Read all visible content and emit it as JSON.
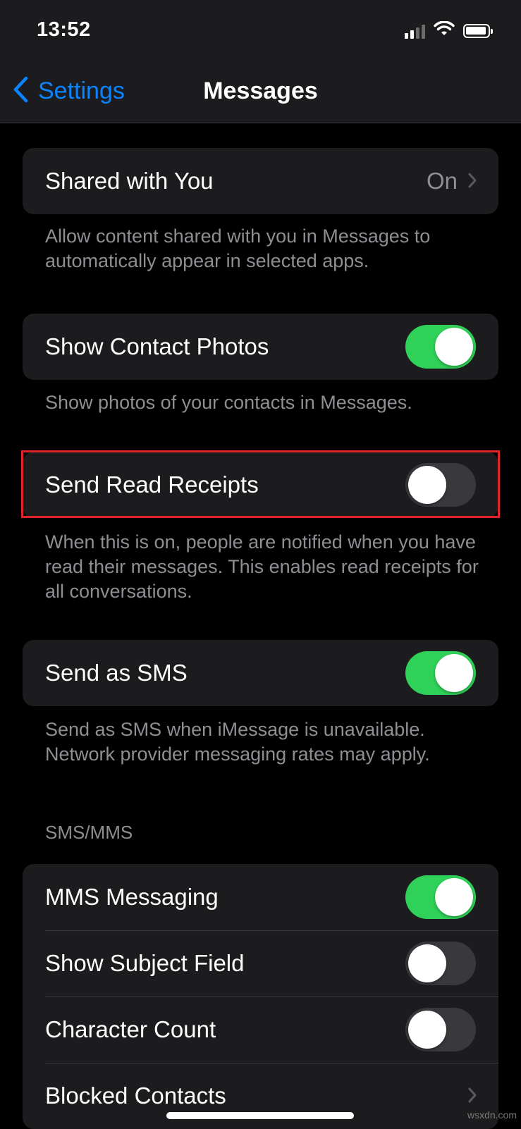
{
  "status_bar": {
    "time": "13:52",
    "signal_icon": "cellular-signal-icon",
    "wifi_icon": "wifi-icon",
    "battery_icon": "battery-icon",
    "battery_level": 0.85
  },
  "nav": {
    "back_label": "Settings",
    "title": "Messages"
  },
  "shared_with_you": {
    "label": "Shared with You",
    "value": "On",
    "footer": "Allow content shared with you in Messages to automatically appear in selected apps."
  },
  "show_contact_photos": {
    "label": "Show Contact Photos",
    "on": true,
    "footer": "Show photos of your contacts in Messages."
  },
  "send_read_receipts": {
    "label": "Send Read Receipts",
    "on": false,
    "footer": "When this is on, people are notified when you have read their messages. This enables read receipts for all conversations."
  },
  "send_as_sms": {
    "label": "Send as SMS",
    "on": true,
    "footer": "Send as SMS when iMessage is unavailable. Network provider messaging rates may apply."
  },
  "sms_mms": {
    "header": "SMS/MMS",
    "mms_messaging": {
      "label": "MMS Messaging",
      "on": true
    },
    "show_subject_field": {
      "label": "Show Subject Field",
      "on": false
    },
    "character_count": {
      "label": "Character Count",
      "on": false
    },
    "blocked_contacts": {
      "label": "Blocked Contacts"
    }
  },
  "watermark": "wsxdn.com",
  "colors": {
    "accent": "#0a84ff",
    "toggle_on": "#30d158",
    "highlight": "#e0242c"
  }
}
